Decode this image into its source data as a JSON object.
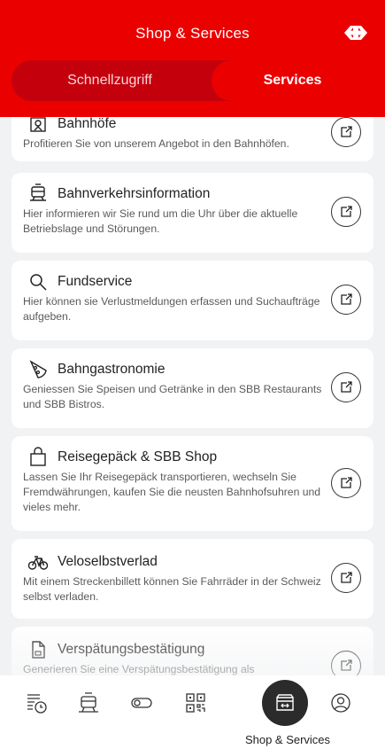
{
  "header": {
    "title": "Shop & Services",
    "logo_icon": "sbb-logo-icon",
    "tabs": [
      {
        "label": "Schnellzugriff",
        "active": false
      },
      {
        "label": "Services",
        "active": true
      }
    ]
  },
  "cards": [
    {
      "icon": "station-icon",
      "title": "Bahnhöfe",
      "description": "Profitieren Sie von unserem Angebot in den Bahnhöfen."
    },
    {
      "icon": "train-info-icon",
      "title": "Bahnverkehrsinformation",
      "description": "Hier informieren wir Sie rund um die Uhr über die aktuelle Betriebslage und Störungen."
    },
    {
      "icon": "search-icon",
      "title": "Fundservice",
      "description": "Hier können sie Verlustmeldungen erfassen und Suchaufträge aufgeben."
    },
    {
      "icon": "pizza-icon",
      "title": "Bahngastronomie",
      "description": "Geniessen Sie Speisen und Getränke in den SBB Restaurants und SBB Bistros."
    },
    {
      "icon": "shopping-bag-icon",
      "title": "Reisegepäck & SBB Shop",
      "description": "Lassen Sie Ihr Reisegepäck transportieren, wechseln Sie Fremdwährungen, kaufen Sie die neusten Bahnhofsuhren und vieles mehr."
    },
    {
      "icon": "bicycle-icon",
      "title": "Veloselbstverlad",
      "description": "Mit einem Streckenbillett können Sie Fahrräder in der Schweiz selbst verladen."
    },
    {
      "icon": "document-icon",
      "title": "Verspätungsbestätigung",
      "description": "Generieren Sie eine Verspätungsbestätigung als"
    }
  ],
  "bottom_nav": {
    "items": [
      {
        "icon": "timetable-icon"
      },
      {
        "icon": "train-icon"
      },
      {
        "icon": "toggle-icon"
      },
      {
        "icon": "qr-code-icon"
      },
      {
        "icon": "shop-services-icon",
        "label": "Shop & Services",
        "active": true
      },
      {
        "icon": "profile-icon"
      }
    ]
  },
  "colors": {
    "brand_red": "#eb0000",
    "dark_red": "#c4000d",
    "background": "#f1f2f4",
    "active_nav": "#2b2b2b"
  }
}
